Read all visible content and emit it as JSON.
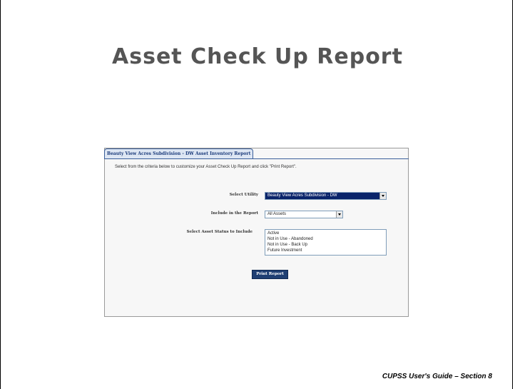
{
  "slide": {
    "title": "Asset Check Up Report",
    "footer": "CUPSS User's Guide – Section 8"
  },
  "panel": {
    "tab_title": "Beauty View Acres Subdivision - DW Asset Inventory Report",
    "instruction": "Select from the criteria below to customize your Asset Check Up Report and click \"Print Report\".",
    "select_utility_label": "Select Utility",
    "select_utility_value": "Beauty View Acres Subdivision - DW",
    "include_label": "Include in the Report",
    "include_value": "All Assets",
    "status_label": "Select Asset Status to Include",
    "status_options": [
      "Active",
      "Not in Use - Abandoned",
      "Not in Use - Back Up",
      "Future Investment"
    ],
    "print_button": "Print Report"
  }
}
